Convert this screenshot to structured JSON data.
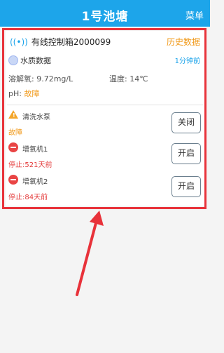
{
  "header": {
    "title": "1号池塘",
    "menu_label": "菜单"
  },
  "controller": {
    "name": "有线控制箱2000099",
    "history_label": "历史数据",
    "signal_icon": "signal-icon"
  },
  "water_quality": {
    "label": "水质数据",
    "updated": "1分钟前",
    "dissolved_oxygen": "溶解氧: 9.72mg/L",
    "temperature": "温度: 14℃",
    "ph_label": "pH: ",
    "ph_value": "故障"
  },
  "devices": [
    {
      "name": "清洗水泵",
      "status": "故障",
      "button": "关闭",
      "icon": "warning-icon",
      "status_color": "#f19a1b"
    },
    {
      "name": "增氧机1",
      "status": "停止:521天前",
      "button": "开启",
      "icon": "stop-icon",
      "status_color": "#e43b3b"
    },
    {
      "name": "增氧机2",
      "status": "停止:84天前",
      "button": "开启",
      "icon": "stop-icon",
      "status_color": "#e43b3b"
    }
  ],
  "colors": {
    "header_bg": "#1da5ea",
    "accent_orange": "#f19a1b",
    "stop_red": "#e43b3b",
    "highlight_border": "#e8323a"
  }
}
